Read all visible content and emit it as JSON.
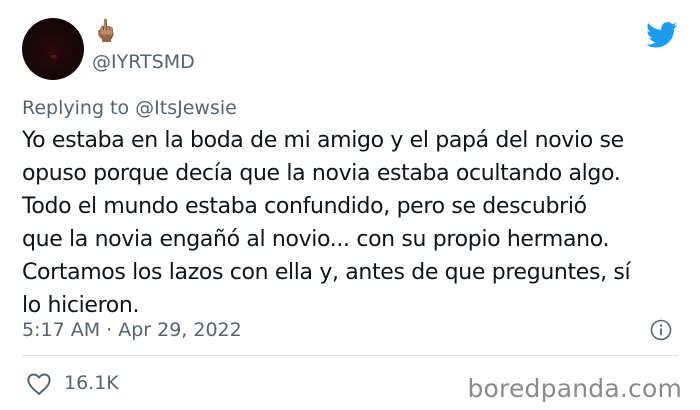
{
  "author": {
    "display_name_emoji": "🖕🏽",
    "username": "@IYRTSMD"
  },
  "reply": {
    "prefix": "Replying to",
    "mention": "@ItsJewsie"
  },
  "tweet": {
    "lines": [
      "Yo estaba en la boda de mi amigo y el papá del novio se",
      "opuso porque decía que la novia estaba ocultando algo.",
      "Todo el mundo estaba confundido, pero se descubrió",
      "que la novia engañó al novio... con su propio hermano.",
      "Cortamos los lazos con ella y, antes de que preguntes, sí",
      "lo hicieron."
    ]
  },
  "meta": {
    "timestamp": "5:17 AM · Apr 29, 2022"
  },
  "engagement": {
    "likes": "16.1K"
  },
  "watermark": "boredpanda.com",
  "icons": {
    "platform": "twitter-bird-icon",
    "info": "info-icon",
    "like": "heart-icon"
  },
  "colors": {
    "twitter_blue": "#1d9bf0",
    "text": "#0f1419",
    "secondary_text": "#536471",
    "divider": "#dfe3e7",
    "watermark": "#8a8a8a"
  }
}
